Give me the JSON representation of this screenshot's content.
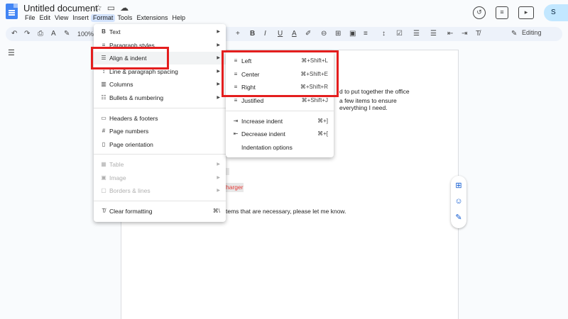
{
  "doc": {
    "title": "Untitled document"
  },
  "menubar": [
    "File",
    "Edit",
    "View",
    "Insert",
    "Format",
    "Tools",
    "Extensions",
    "Help"
  ],
  "toolbar": {
    "zoom": "100%",
    "mode": "Editing"
  },
  "share": {
    "label": "S"
  },
  "format_menu": {
    "items": [
      {
        "icon": "B",
        "label": "Text",
        "has_sub": true
      },
      {
        "icon": "≡",
        "label": "Paragraph styles",
        "has_sub": true
      },
      {
        "icon": "☰",
        "label": "Align & indent",
        "has_sub": true
      },
      {
        "icon": "↕",
        "label": "Line & paragraph spacing",
        "has_sub": true
      },
      {
        "icon": "▥",
        "label": "Columns",
        "has_sub": true
      },
      {
        "icon": "☷",
        "label": "Bullets & numbering",
        "has_sub": true
      },
      {
        "icon": "▭",
        "label": "Headers & footers",
        "has_sub": false
      },
      {
        "icon": "#",
        "label": "Page numbers",
        "has_sub": false
      },
      {
        "icon": "▯",
        "label": "Page orientation",
        "has_sub": false
      },
      {
        "icon": "▦",
        "label": "Table",
        "has_sub": true
      },
      {
        "icon": "▣",
        "label": "Image",
        "has_sub": true
      },
      {
        "icon": "▢",
        "label": "Borders & lines",
        "has_sub": true
      },
      {
        "icon": "T̸",
        "label": "Clear formatting",
        "shortcut": "⌘\\"
      }
    ]
  },
  "align_menu": {
    "items": [
      {
        "label": "Left",
        "shortcut": "⌘+Shift+L"
      },
      {
        "label": "Center",
        "shortcut": "⌘+Shift+E"
      },
      {
        "label": "Right",
        "shortcut": "⌘+Shift+R"
      },
      {
        "label": "Justified",
        "shortcut": "⌘+Shift+J"
      },
      {
        "label": "Increase indent",
        "shortcut": "⌘+]"
      },
      {
        "label": "Decrease indent",
        "shortcut": "⌘+["
      },
      {
        "label": "Indentation options",
        "shortcut": ""
      }
    ]
  },
  "document_text": {
    "line1": "d to put together the office",
    "line2": "a few items to ensure",
    "line3": "everything I need.",
    "line4": "harger",
    "line5": "tems that are necessary, please let me know."
  }
}
